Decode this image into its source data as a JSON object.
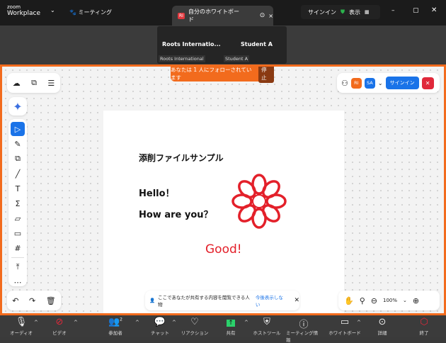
{
  "titlebar": {
    "logo_top": "zoom",
    "logo_bottom": "Workplace",
    "meeting": "ミーティング",
    "tab_badge": "RI",
    "tab_title": "自分のホワイトボード",
    "signin": "サインイン",
    "view": "表示"
  },
  "participants": [
    {
      "name": "Roots  Internatio...",
      "label": "Roots International"
    },
    {
      "name": "Student A",
      "label": "Student A"
    }
  ],
  "banner": {
    "text": "あなたは 1 人にフォローされています",
    "stop": "停止"
  },
  "whiteboard_top_right": {
    "avatars": [
      "RI",
      "SA"
    ],
    "signin": "サインイン",
    "colors": {
      "ri": "#f26b1d",
      "sa": "#1a73e8"
    }
  },
  "document": {
    "title": "添削ファイルサンプル",
    "line1": "Hello！",
    "line2": "How are you？",
    "comment": "Good!"
  },
  "notice": {
    "text": "ここであなたが共有する内容を閲覧できる人物",
    "link": "今後表示しない"
  },
  "zoom": {
    "level": "100%"
  },
  "toolbar": {
    "participants_count": "2",
    "items": [
      "オーディオ",
      "ビデオ",
      "参加者",
      "チャット",
      "リアクション",
      "共有",
      "ホストツール",
      "ミーティング情報",
      "ホワイトボード",
      "詳細",
      "終了"
    ]
  },
  "colors": {
    "accent": "#f26b1d",
    "annotation": "#e3202a",
    "primary": "#1a73e8"
  }
}
